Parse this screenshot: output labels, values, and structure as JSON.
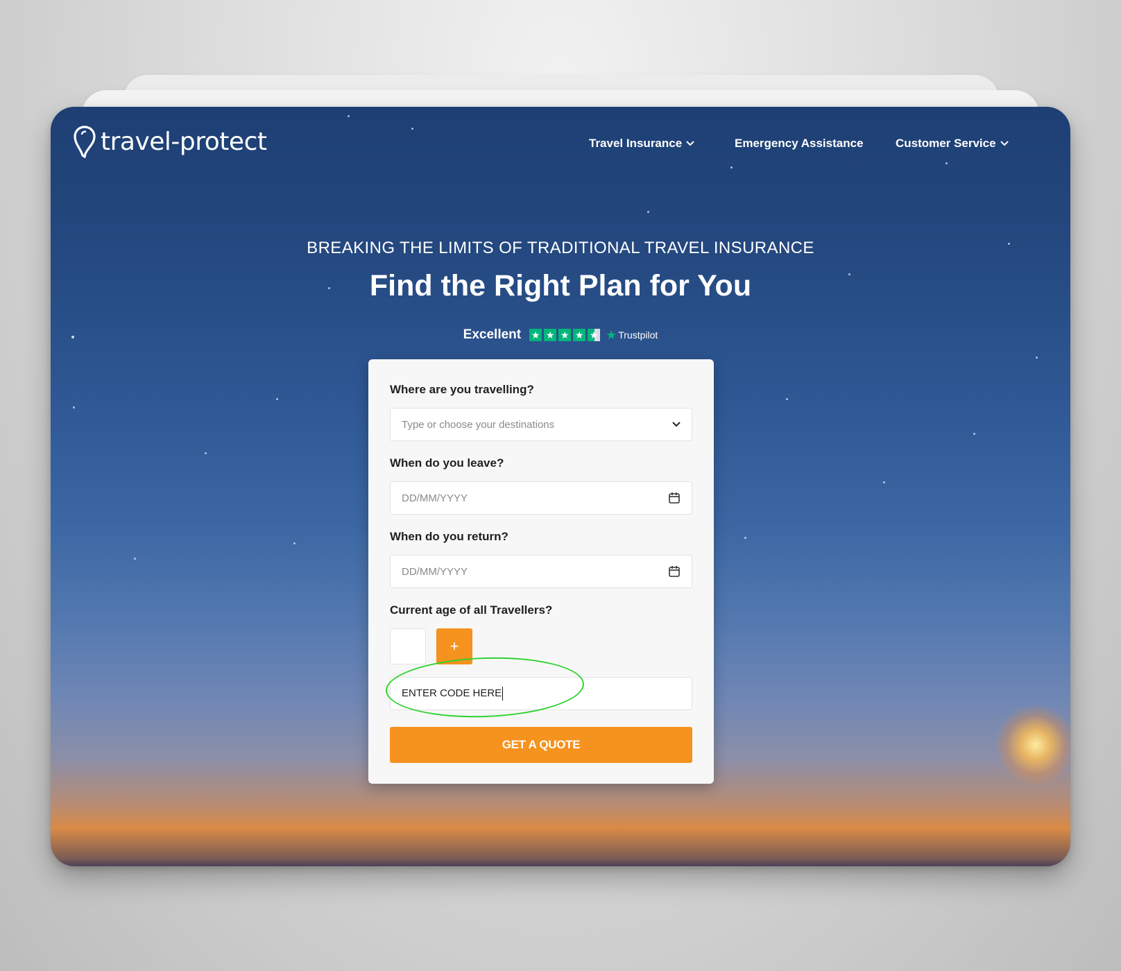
{
  "brand": {
    "logo_text": "travel-protect"
  },
  "nav": {
    "items": [
      {
        "label": "Travel Insurance",
        "has_dropdown": true
      },
      {
        "label": "Emergency Assistance",
        "has_dropdown": false
      },
      {
        "label": "Customer Service",
        "has_dropdown": true
      }
    ]
  },
  "hero": {
    "subtitle": "BREAKING THE LIMITS OF TRADITIONAL TRAVEL INSURANCE",
    "headline": "Find the Right Plan for You",
    "trust": {
      "label": "Excellent",
      "provider": "Trustpilot",
      "rating_stars": 4.5
    }
  },
  "form": {
    "destination": {
      "label": "Where are you travelling?",
      "placeholder": "Type or choose your destinations"
    },
    "leave": {
      "label": "When do you leave?",
      "placeholder": "DD/MM/YYYY"
    },
    "return": {
      "label": "When do you return?",
      "placeholder": "DD/MM/YYYY"
    },
    "ages": {
      "label": "Current age of all Travellers?",
      "add_label": "+"
    },
    "promo": {
      "value": "ENTER CODE HERE"
    },
    "submit_label": "GET A QUOTE"
  },
  "colors": {
    "accent": "#f6921e",
    "trustpilot": "#00b67a",
    "highlight": "#2ed22e"
  }
}
